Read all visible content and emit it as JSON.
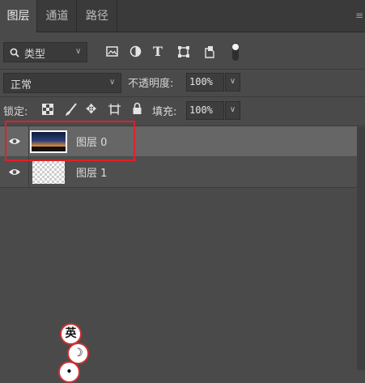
{
  "panel": {
    "tabs": [
      "图层",
      "通道",
      "路径"
    ],
    "active_tab": 0,
    "menu_icon": "menu-lines-icon"
  },
  "filter": {
    "kind_label": "类型",
    "icons": [
      "image-filter-icon",
      "adjustment-filter-icon",
      "type-filter-icon",
      "shape-filter-icon",
      "smart-object-filter-icon",
      "filter-toggle-icon"
    ]
  },
  "blend": {
    "mode": "正常",
    "opacity_label": "不透明度:",
    "opacity_value": "100%"
  },
  "lock": {
    "label": "锁定:",
    "icons": [
      "lock-transparent-icon",
      "lock-image-icon",
      "lock-position-icon",
      "lock-artboard-icon",
      "lock-all-icon"
    ],
    "fill_label": "填充:",
    "fill_value": "100%"
  },
  "layers": [
    {
      "name": "图层 0",
      "visible": true,
      "selected": true,
      "thumbnail": "sunset-landscape"
    },
    {
      "name": "图层 1",
      "visible": true,
      "selected": false,
      "thumbnail": "transparent-checkerboard"
    }
  ],
  "ime": {
    "lang": "英",
    "mode_icon": "moon-icon"
  },
  "colors": {
    "highlight": "#e0202a",
    "selected_row": "#666666",
    "panel_bg": "#4a4a4a"
  }
}
